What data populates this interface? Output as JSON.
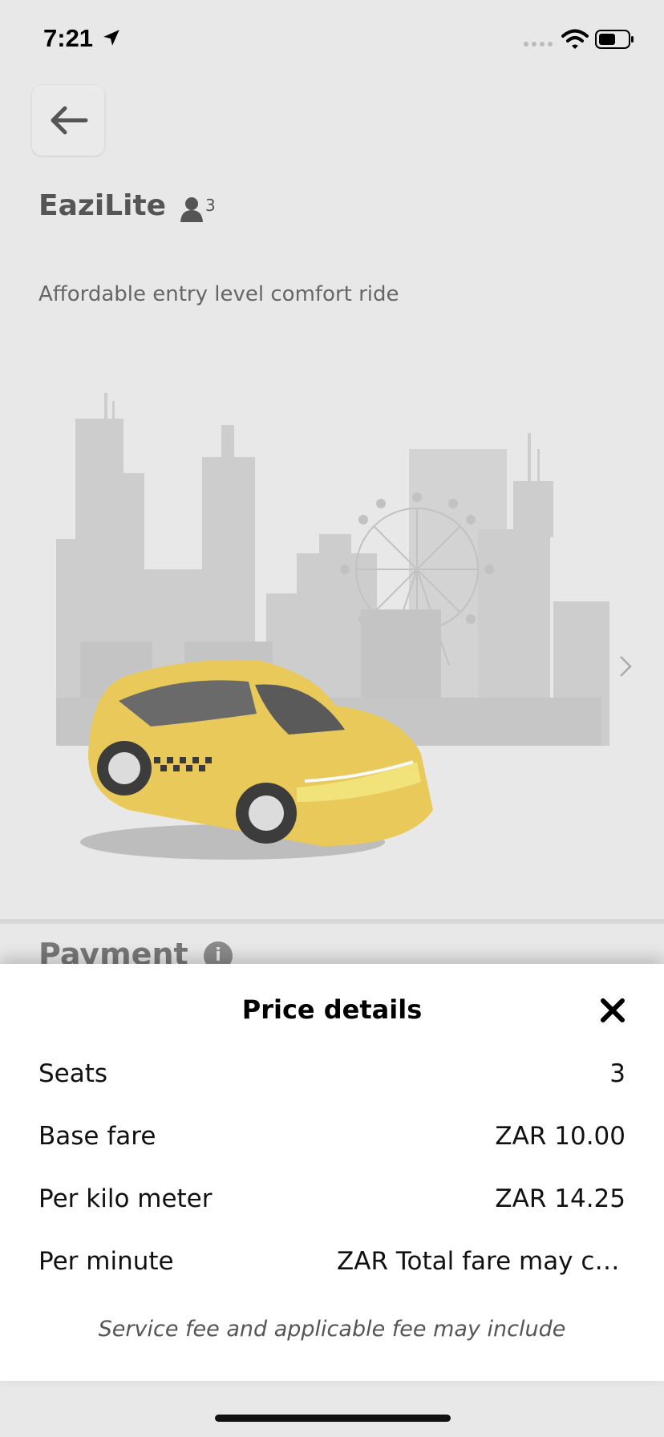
{
  "status_bar": {
    "time": "7:21"
  },
  "ride": {
    "name": "EaziLite",
    "seats_badge": "3",
    "description": "Affordable entry level comfort ride"
  },
  "payment": {
    "heading": "Payment",
    "info_glyph": "i"
  },
  "price_details": {
    "title": "Price details",
    "rows": [
      {
        "label": "Seats",
        "value": "3"
      },
      {
        "label": "Base fare",
        "value": "ZAR 10.00"
      },
      {
        "label": "Per kilo meter",
        "value": "ZAR 14.25"
      },
      {
        "label": "Per minute",
        "value": "ZAR Total fare may change"
      }
    ],
    "note": "Service fee and applicable fee may include"
  },
  "colors": {
    "background": "#e8e8e8",
    "sheet": "#ffffff",
    "taxi_yellow": "#e8c95a",
    "skyline_gray": "#c9c9c9"
  },
  "icons": [
    "back-arrow-icon",
    "person-icon",
    "info-icon",
    "close-icon",
    "chevron-right-icon",
    "location-arrow-icon",
    "wifi-icon",
    "battery-icon",
    "signal-icon"
  ]
}
